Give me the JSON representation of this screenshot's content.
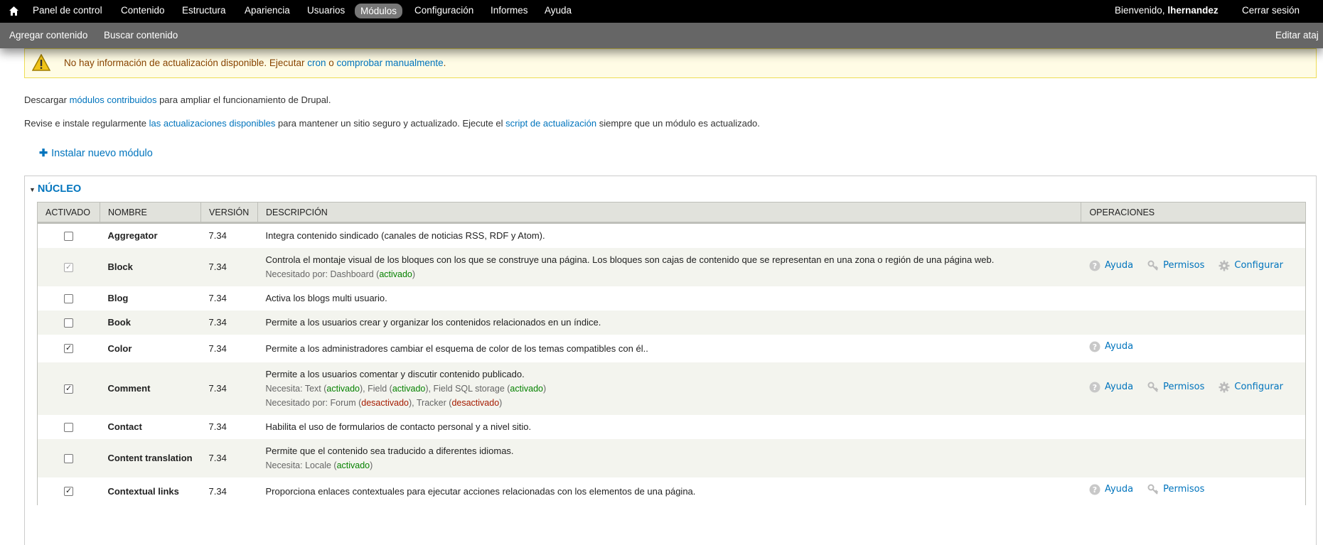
{
  "toolbar": {
    "menu": [
      "Panel de control",
      "Contenido",
      "Estructura",
      "Apariencia",
      "Usuarios",
      "Módulos",
      "Configuración",
      "Informes",
      "Ayuda"
    ],
    "active": "Módulos",
    "welcome": "Bienvenido,",
    "username": "lhernandez",
    "logout": "Cerrar sesión"
  },
  "shortcuts": {
    "items": [
      "Agregar contenido",
      "Buscar contenido"
    ],
    "edit": "Editar ataj"
  },
  "warning": {
    "text": "No hay información de actualización disponible. Ejecutar",
    "link1": "cron",
    "mid": "o",
    "link2": "comprobar manualmente",
    "end": "."
  },
  "intro": {
    "p1_a": "Descargar",
    "p1_link": "módulos contribuidos",
    "p1_b": "para ampliar el funcionamiento de Drupal.",
    "p2_a": "Revise e instale regularmente",
    "p2_link1": "las actualizaciones disponibles",
    "p2_b": "para mantener un sitio seguro y actualizado. Ejecute el",
    "p2_link2": "script de actualización",
    "p2_c": "siempre que un módulo es actualizado."
  },
  "install_link": "Instalar nuevo módulo",
  "fieldset": {
    "legend": "NÚCLEO"
  },
  "table": {
    "headers": [
      "ACTIVADO",
      "NOMBRE",
      "VERSIÓN",
      "DESCRIPCIÓN",
      "OPERACIONES"
    ],
    "rows": [
      {
        "name": "Aggregator",
        "version": "7.34",
        "enabled": false,
        "disabled": false,
        "description": "Integra contenido sindicado (canales de noticias RSS, RDF y Atom).",
        "notes": [],
        "ops": []
      },
      {
        "name": "Block",
        "version": "7.34",
        "enabled": true,
        "disabled": true,
        "description": "Controla el montaje visual de los bloques con los que se construye una página. Los bloques son cajas de contenido que se representan en una zona o región de una página web.",
        "notes": [
          {
            "label": "Necesitado por:",
            "deps": [
              {
                "name": "Dashboard",
                "status": "activado"
              }
            ]
          }
        ],
        "ops": [
          "Ayuda",
          "Permisos",
          "Configurar"
        ]
      },
      {
        "name": "Blog",
        "version": "7.34",
        "enabled": false,
        "disabled": false,
        "description": "Activa los blogs multi usuario.",
        "notes": [],
        "ops": []
      },
      {
        "name": "Book",
        "version": "7.34",
        "enabled": false,
        "disabled": false,
        "description": "Permite a los usuarios crear y organizar los contenidos relacionados en un índice.",
        "notes": [],
        "ops": []
      },
      {
        "name": "Color",
        "version": "7.34",
        "enabled": true,
        "disabled": false,
        "description": "Permite a los administradores cambiar el esquema de color de los temas compatibles con él..",
        "notes": [],
        "ops": [
          "Ayuda"
        ]
      },
      {
        "name": "Comment",
        "version": "7.34",
        "enabled": true,
        "disabled": false,
        "description": "Permite a los usuarios comentar y discutir contenido publicado.",
        "notes": [
          {
            "label": "Necesita:",
            "deps": [
              {
                "name": "Text",
                "status": "activado"
              },
              {
                "name": "Field",
                "status": "activado"
              },
              {
                "name": "Field SQL storage",
                "status": "activado"
              }
            ]
          },
          {
            "label": "Necesitado por:",
            "deps": [
              {
                "name": "Forum",
                "status": "desactivado"
              },
              {
                "name": "Tracker",
                "status": "desactivado"
              }
            ]
          }
        ],
        "ops": [
          "Ayuda",
          "Permisos",
          "Configurar"
        ]
      },
      {
        "name": "Contact",
        "version": "7.34",
        "enabled": false,
        "disabled": false,
        "description": "Habilita el uso de formularios de contacto personal y a nivel sitio.",
        "notes": [],
        "ops": []
      },
      {
        "name": "Content translation",
        "version": "7.34",
        "enabled": false,
        "disabled": false,
        "description": "Permite que el contenido sea traducido a diferentes idiomas.",
        "notes": [
          {
            "label": "Necesita:",
            "deps": [
              {
                "name": "Locale",
                "status": "activado"
              }
            ]
          }
        ],
        "ops": []
      },
      {
        "name": "Contextual links",
        "version": "7.34",
        "enabled": true,
        "disabled": false,
        "description": "Proporciona enlaces contextuales para ejecutar acciones relacionadas con los elementos de una página.",
        "notes": [],
        "ops": [
          "Ayuda",
          "Permisos"
        ]
      }
    ]
  },
  "colors": {
    "link": "#0074bd",
    "enabled": "#068200",
    "disabled": "#a51b00",
    "header_bg": "#e1e2dc",
    "even_row": "#f3f4ee"
  }
}
